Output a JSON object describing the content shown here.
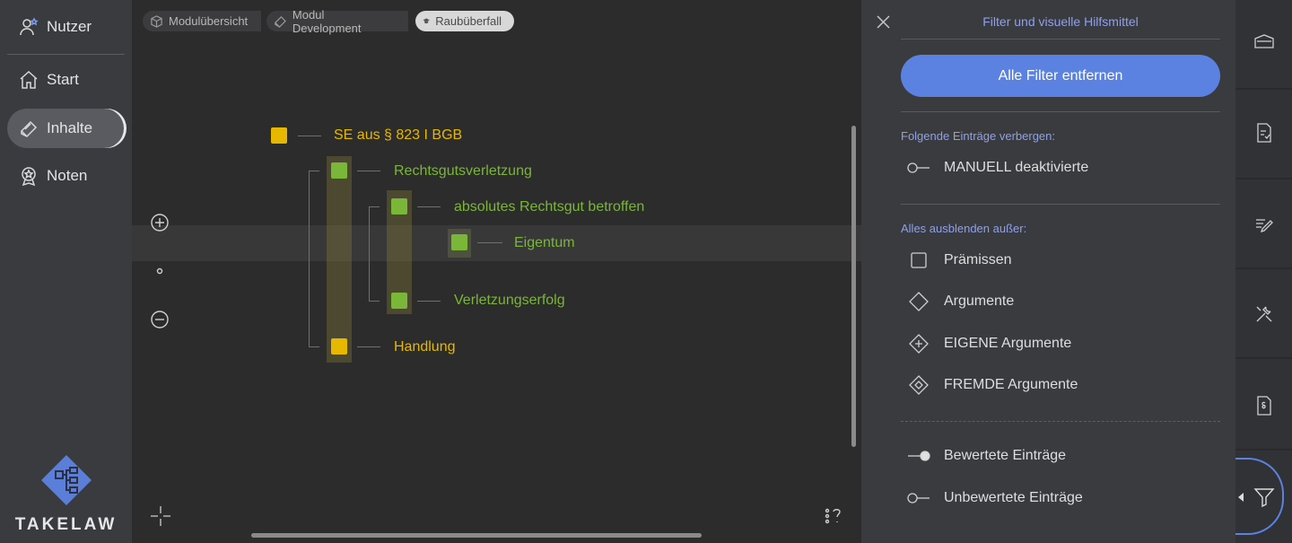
{
  "sidebar": {
    "items": [
      {
        "label": "Nutzer",
        "icon": "user-icon"
      },
      {
        "label": "Start",
        "icon": "home-icon"
      },
      {
        "label": "Inhalte",
        "icon": "book-icon",
        "active": true
      },
      {
        "label": "Noten",
        "icon": "award-icon"
      }
    ],
    "logo_text": "TAKELAW"
  },
  "breadcrumbs": [
    "Modulübersicht",
    "Modul Development",
    "Raubüberfall"
  ],
  "tree": {
    "nodes": [
      {
        "label": "SE aus § 823 I BGB",
        "color": "#e6b800"
      },
      {
        "label": "Rechtsgutsverletzung",
        "color": "#7ab637"
      },
      {
        "label": "absolutes Rechtsgut betroffen",
        "color": "#7ab637"
      },
      {
        "label": "Eigentum",
        "color": "#7ab637"
      },
      {
        "label": "Verletzungserfolg",
        "color": "#7ab637"
      },
      {
        "label": "Handlung",
        "color": "#e6b800"
      }
    ]
  },
  "panel": {
    "title": "Filter und visuelle Hilfsmittel",
    "remove_all_label": "Alle Filter entfernen",
    "hide_section_title": "Folgende Einträge verbergen:",
    "hide_options": [
      {
        "label": "MANUELL deaktivierte",
        "icon": "toggle-off-icon"
      }
    ],
    "show_section_title": "Alles ausblenden außer:",
    "show_options": [
      {
        "label": "Prämissen",
        "icon": "square-icon"
      },
      {
        "label": "Argumente",
        "icon": "diamond-icon"
      },
      {
        "label": "EIGENE Argumente",
        "icon": "diamond-plus-icon"
      },
      {
        "label": "FREMDE Argumente",
        "icon": "diamond-dot-icon"
      }
    ],
    "rating_options": [
      {
        "label": "Bewertete Einträge",
        "icon": "toggle-on-icon"
      },
      {
        "label": "Unbewertete Einträge",
        "icon": "toggle-off-icon"
      }
    ]
  },
  "colors": {
    "accent": "#5b82e0",
    "yellow_node": "#e6b800",
    "green_node": "#7ab637"
  }
}
